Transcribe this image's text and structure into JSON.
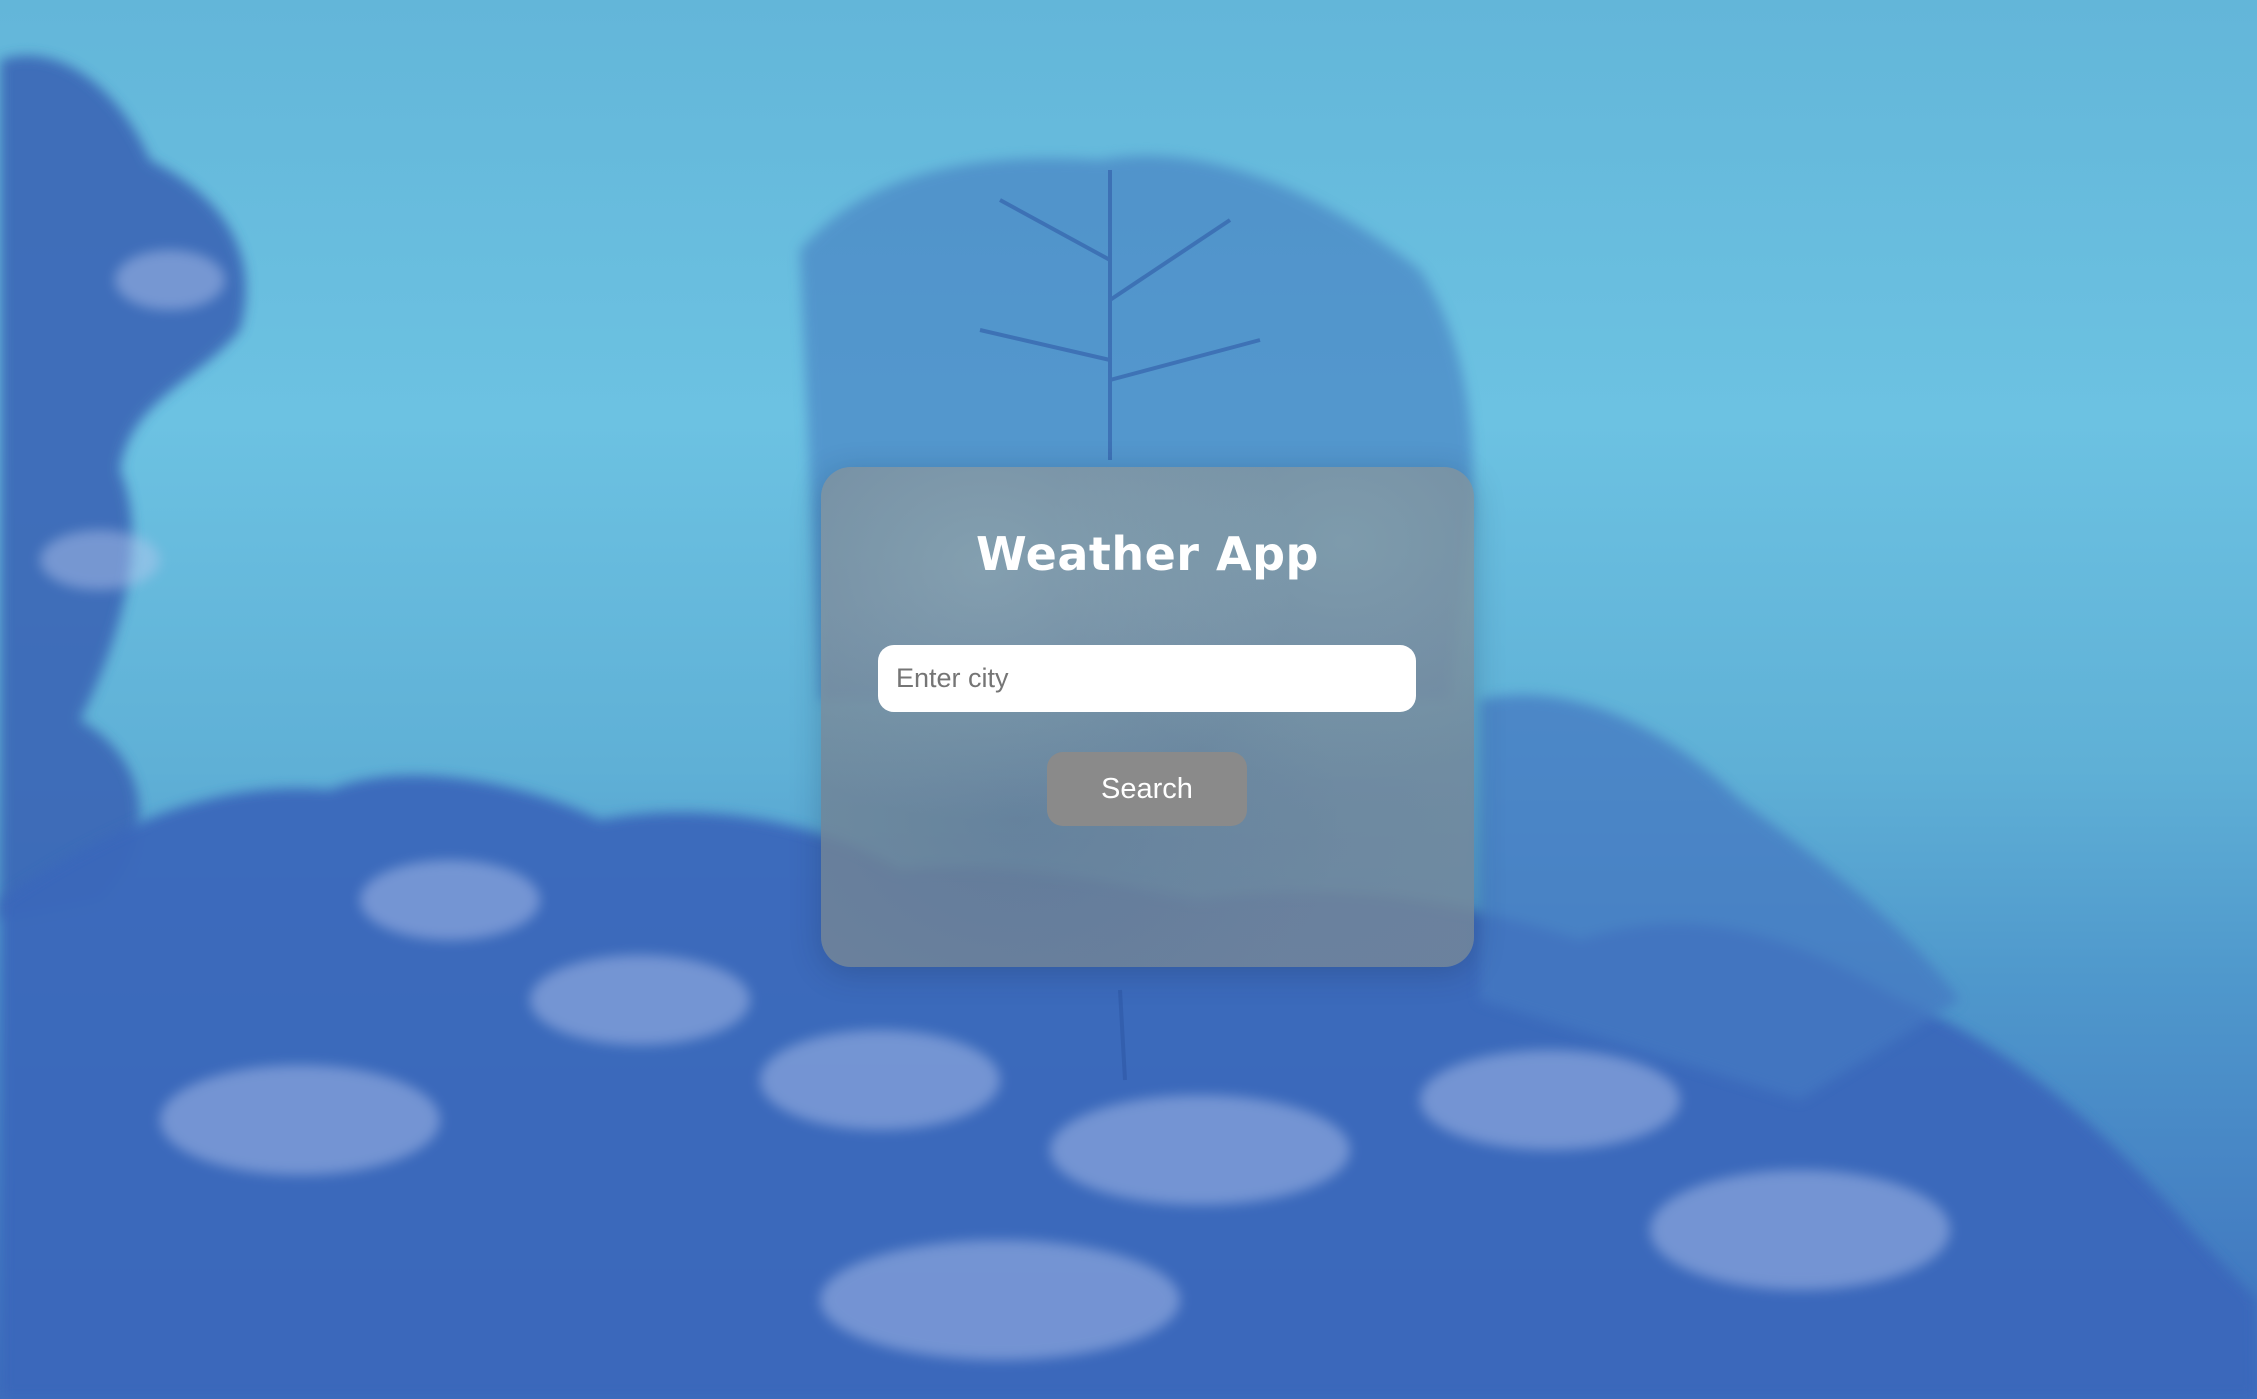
{
  "app": {
    "title": "Weather App"
  },
  "search": {
    "placeholder": "Enter city",
    "value": "",
    "button_label": "Search"
  },
  "colors": {
    "sky": "#6cc2e2",
    "trees": "#3d6fbd",
    "card": "#768896",
    "button": "#8a8a8a",
    "text": "#ffffff"
  }
}
